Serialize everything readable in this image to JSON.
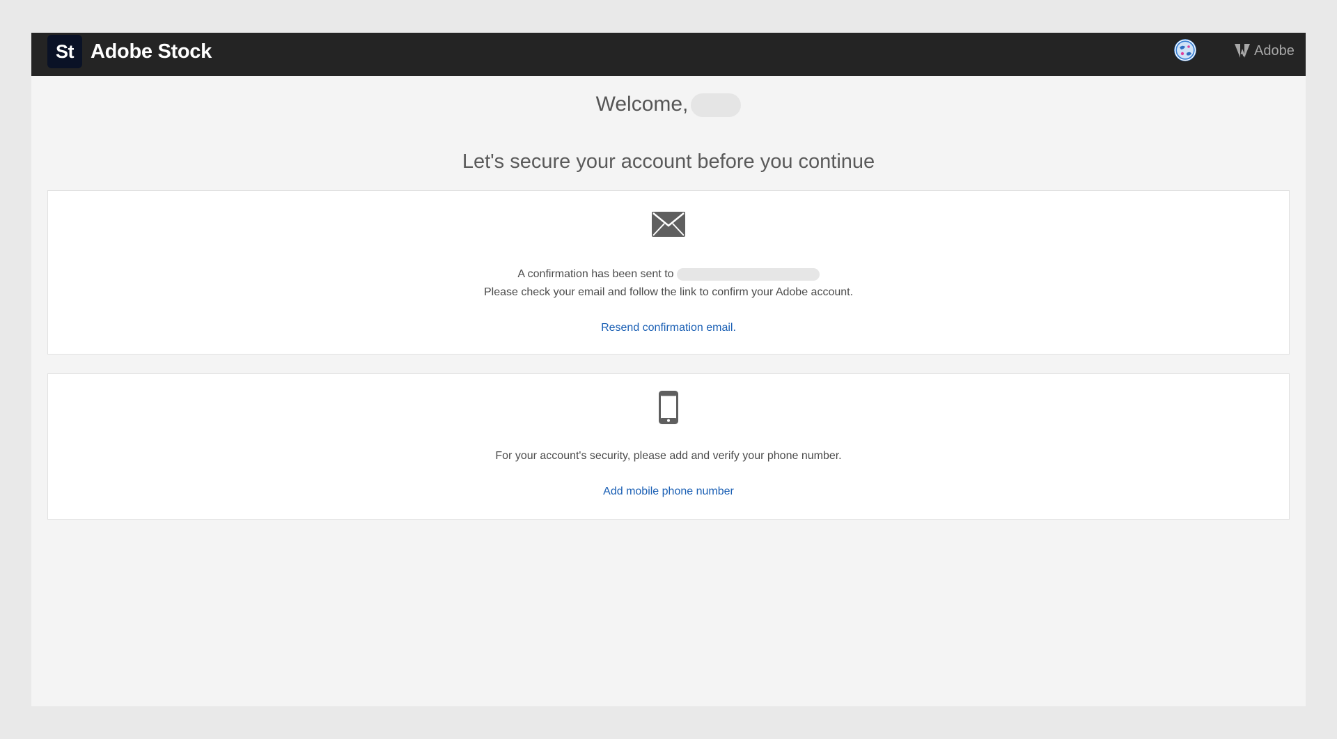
{
  "header": {
    "logo_text": "St",
    "brand_name": "Adobe Stock",
    "avatar_icon": "avatar-globe-icon",
    "adobe_label": "Adobe",
    "background_color": "#242424"
  },
  "page": {
    "welcome_text": "Welcome,",
    "subtitle": "Let's secure your account before you continue"
  },
  "email_card": {
    "icon": "envelope-icon",
    "line1": "A confirmation has been sent to",
    "line2": "Please check your email and follow the link to confirm your Adobe account.",
    "link_label": "Resend confirmation email."
  },
  "phone_card": {
    "icon": "mobile-phone-icon",
    "text": "For your account's security, please add and verify your phone number.",
    "link_label": "Add mobile phone number"
  },
  "colors": {
    "link": "#1a5fb4",
    "page_background": "#f4f4f4",
    "card_background": "#ffffff"
  }
}
